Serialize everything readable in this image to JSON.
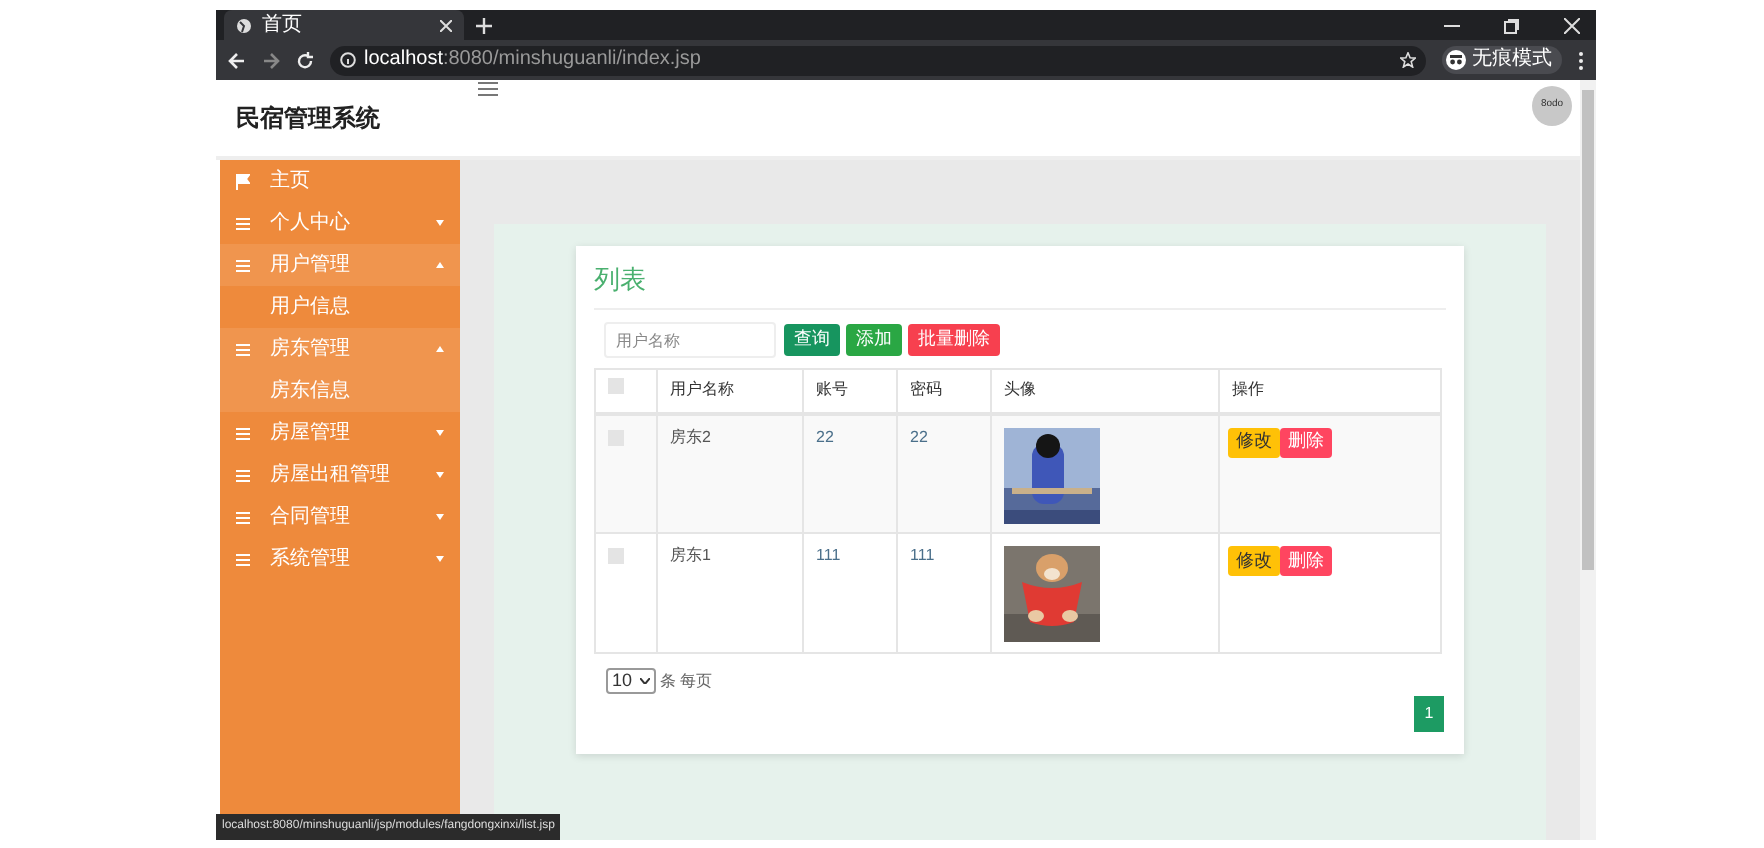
{
  "browser": {
    "tab_title": "首页",
    "url_host": "localhost",
    "url_rest": ":8080/minshuguanli/index.jsp",
    "profile_label": "无痕模式"
  },
  "header": {
    "title": "民宿管理系统",
    "avatar_text": "8odo"
  },
  "sidebar": {
    "items": [
      {
        "kind": "home",
        "label": "主页",
        "expanded": false
      },
      {
        "kind": "menu",
        "label": "个人中心",
        "expanded": false
      },
      {
        "kind": "menu",
        "label": "用户管理",
        "expanded": true,
        "children": [
          {
            "label": "用户信息",
            "selected": false
          }
        ]
      },
      {
        "kind": "menu",
        "label": "房东管理",
        "expanded": true,
        "children": [
          {
            "label": "房东信息",
            "selected": true
          }
        ]
      },
      {
        "kind": "menu",
        "label": "房屋管理",
        "expanded": false
      },
      {
        "kind": "menu",
        "label": "房屋出租管理",
        "expanded": false
      },
      {
        "kind": "menu",
        "label": "合同管理",
        "expanded": false
      },
      {
        "kind": "menu",
        "label": "系统管理",
        "expanded": false
      }
    ]
  },
  "panel": {
    "title": "列表",
    "search": {
      "placeholder": "用户名称"
    },
    "buttons": [
      {
        "label": "查询",
        "kind": "primary"
      },
      {
        "label": "添加",
        "kind": "success"
      },
      {
        "label": "批量删除",
        "kind": "danger"
      }
    ],
    "table": {
      "select_all_checked": false,
      "columns": [
        "用户名称",
        "账号",
        "密码",
        "头像",
        "操作"
      ],
      "rows": [
        {
          "checked": false,
          "cells": [
            "房东2",
            "22",
            "22"
          ],
          "actions": [
            "修改",
            "删除"
          ]
        },
        {
          "checked": false,
          "cells": [
            "房东1",
            "111",
            "111"
          ],
          "actions": [
            "修改",
            "删除"
          ]
        }
      ]
    },
    "page_size": "10",
    "per_page_label": "条 每页",
    "pages": [
      {
        "label": "1",
        "selected": true
      }
    ]
  },
  "status_url": "localhost:8080/minshuguanli/jsp/modules/fangdongxinxi/list.jsp"
}
